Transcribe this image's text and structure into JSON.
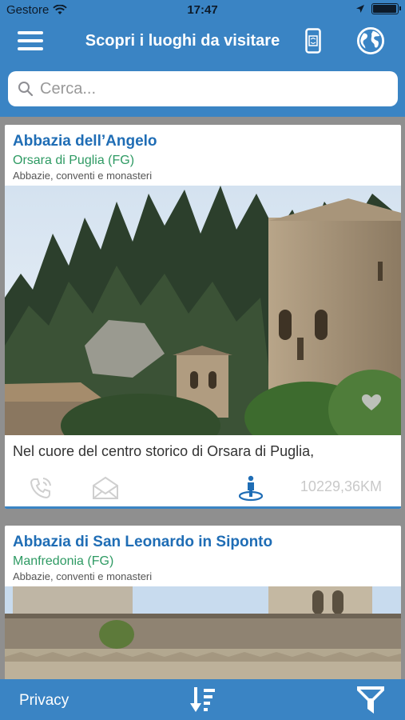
{
  "status_bar": {
    "carrier": "Gestore",
    "time": "17:47",
    "battery_level": 0.95
  },
  "nav": {
    "title": "Scopri i luoghi da visitare",
    "icons": [
      "hamburger-menu-icon",
      "phone-device-icon",
      "globe-icon"
    ]
  },
  "search": {
    "placeholder": "Cerca..."
  },
  "places": [
    {
      "name": "Abbazia dell’Angelo",
      "city": "Orsara di Puglia (FG)",
      "category": "Abbazie, conventi e monasteri",
      "description": "Nel cuore del centro storico di Orsara di Puglia,",
      "distance": "10229,36KM",
      "actions": [
        "phone-call-icon",
        "email-icon",
        "walking-person-icon"
      ]
    },
    {
      "name": "Abbazia di San Leonardo in Siponto",
      "city": "Manfredonia (FG)",
      "category": "Abbazie, conventi e monasteri"
    }
  ],
  "footer": {
    "privacy_label": "Privacy",
    "icons": [
      "sort-icon",
      "filter-icon"
    ]
  },
  "colors": {
    "primary": "#3a84c4",
    "title_blue": "#1f6db5",
    "city_green": "#2e9a63"
  }
}
